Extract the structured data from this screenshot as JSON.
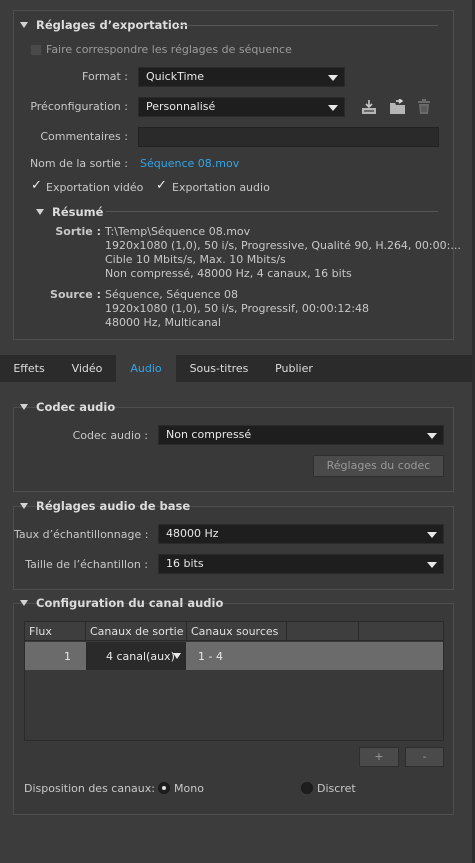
{
  "export_settings": {
    "header": "Réglages d’exportation",
    "match_sequence_label": "Faire correspondre les réglages de séquence",
    "format_label": "Format :",
    "format_value": "QuickTime",
    "preset_label": "Préconfiguration :",
    "preset_value": "Personnalisé",
    "comments_label": "Commentaires :",
    "comments_value": "",
    "output_name_label": "Nom de la sortie :",
    "output_name_value": "Séquence 08.mov",
    "export_video_label": "Exportation vidéo",
    "export_audio_label": "Exportation audio",
    "icons": [
      "save-preset-icon",
      "import-preset-icon",
      "delete-preset-icon"
    ]
  },
  "summary": {
    "header": "Résumé",
    "output_label": "Sortie :",
    "output_lines": [
      "T:\\Temp\\Séquence 08.mov",
      "1920x1080 (1,0), 50 i/s, Progressive, Qualité  90, H.264, 00:00:...",
      "Cible 10 Mbits/s, Max. 10 Mbits/s",
      "Non compressé, 48000  Hz, 4 canaux, 16 bits"
    ],
    "source_label": "Source :",
    "source_lines": [
      "Séquence, Séquence 08",
      "1920x1080 (1,0), 50  i/s, Progressif, 00:00:12:48",
      "48000 Hz, Multicanal"
    ]
  },
  "tabs": [
    "Effets",
    "Vidéo",
    "Audio",
    "Sous-titres",
    "Publier"
  ],
  "active_tab": "Audio",
  "audio_codec": {
    "header": "Codec audio",
    "codec_label": "Codec audio :",
    "codec_value": "Non compressé",
    "codec_settings_button": "Réglages du codec"
  },
  "basic_audio": {
    "header": "Réglages audio de base",
    "sample_rate_label": "Taux d’échantillonnage :",
    "sample_rate_value": "48000 Hz",
    "sample_size_label": "Taille de l’échantillon :",
    "sample_size_value": "16 bits"
  },
  "channel_config": {
    "header": "Configuration du canal audio",
    "columns": [
      "Flux",
      "Canaux de sortie",
      "Canaux sources",
      ""
    ],
    "rows": [
      {
        "stream": "1",
        "output_channels": "4 canal(aux)",
        "source_channels": "1 - 4"
      }
    ],
    "add_button": "+",
    "remove_button": "-",
    "layout_label": "Disposition des canaux:",
    "layout_options": [
      "Mono",
      "Discret"
    ],
    "layout_selected": "Mono"
  },
  "colors": {
    "accent": "#2fa7e8",
    "background": "#3c3c3c",
    "field": "#1e1e1e"
  }
}
